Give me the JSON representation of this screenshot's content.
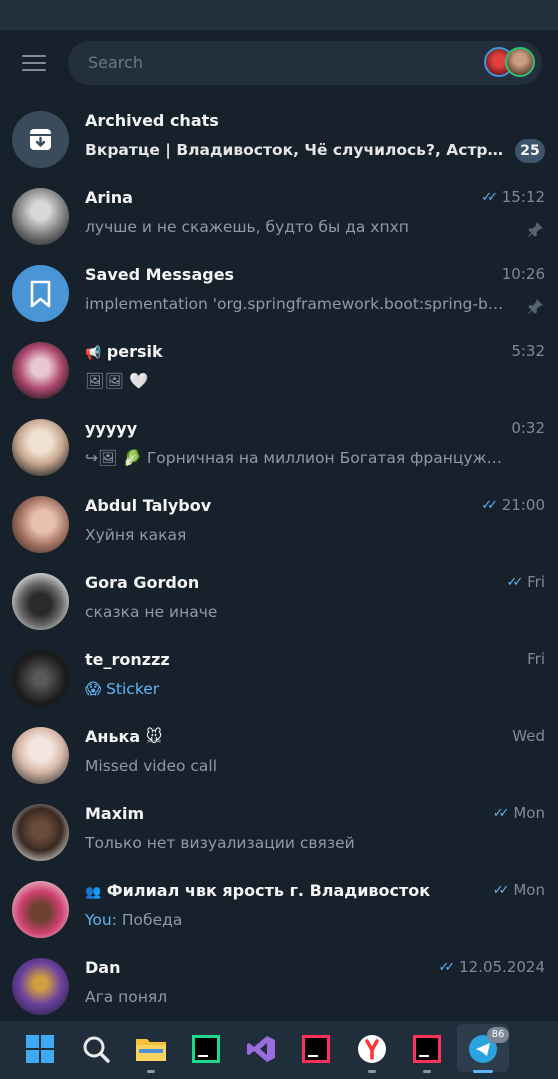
{
  "search": {
    "placeholder": "Search"
  },
  "archived": {
    "name": "Archived chats",
    "preview": "Вкратце | Владивосток, Чё случилось?, Астро Жур...",
    "badge": "25"
  },
  "chats": [
    {
      "name": "Arina",
      "preview": "лучше и не скажешь, будто бы да хпхп",
      "time": "15:12",
      "read": true,
      "pinned": true
    },
    {
      "name": "Saved Messages",
      "preview": "implementation 'org.springframework.boot:spring-boo...",
      "time": "10:26",
      "read": false,
      "pinned": true
    },
    {
      "name": "persik",
      "name_prefix": "📢",
      "preview": "🖼🖼 🤍",
      "time": "5:32",
      "read": false,
      "pinned": false
    },
    {
      "name": "yyyyy",
      "preview": "↪🖼 🥬 Горничная на миллион  Богатая француженка ...",
      "time": "0:32",
      "read": false,
      "pinned": false
    },
    {
      "name": "Abdul Talybov",
      "preview": "Хуйня какая",
      "time": "21:00",
      "read": true,
      "pinned": false
    },
    {
      "name": "Gora Gordon",
      "preview": "сказка не иначе",
      "time": "Fri",
      "read": true,
      "pinned": false
    },
    {
      "name": "te_ronzzz",
      "preview": "😱 Sticker",
      "time": "Fri",
      "read": false,
      "pinned": false,
      "preview_blue": true
    },
    {
      "name": "Анька 🐭",
      "preview": "Missed video call",
      "time": "Wed",
      "read": false,
      "pinned": false
    },
    {
      "name": "Maxim",
      "preview": "Только нет визуализации связей",
      "time": "Mon",
      "read": true,
      "pinned": false
    },
    {
      "name": "Филиал чвк ярость г. Владивосток",
      "name_prefix": "👥",
      "sender": "You: ",
      "preview": "Победа",
      "time": "Mon",
      "read": true,
      "pinned": false
    },
    {
      "name": "Dan",
      "preview": "Ага понял",
      "time": "12.05.2024",
      "read": true,
      "pinned": false
    }
  ],
  "taskbar": {
    "telegram_badge": "86"
  },
  "colors": {
    "accent": "#5eb5f7",
    "background": "#17212b",
    "panel": "#242f3d"
  }
}
